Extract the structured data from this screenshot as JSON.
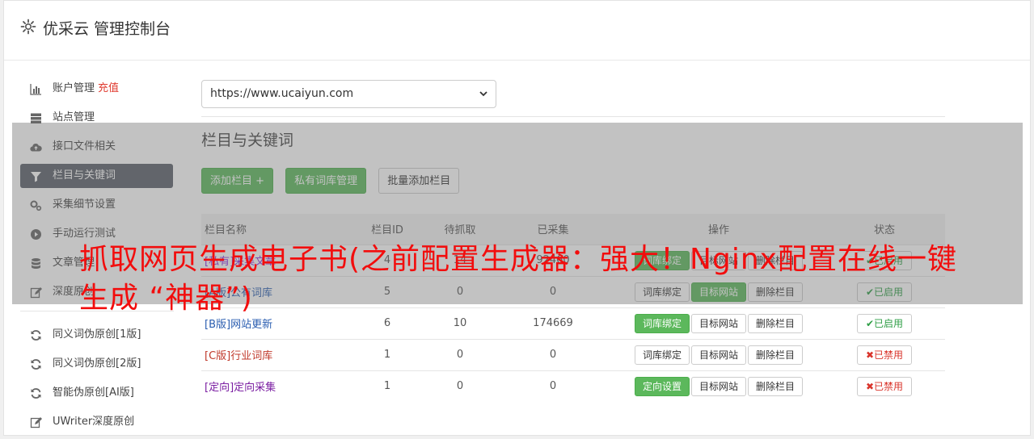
{
  "header": {
    "title": "优采云 管理控制台",
    "icon": "gear-icon"
  },
  "sidebar": {
    "items": [
      {
        "label": "账户管理",
        "extra": "充值",
        "icon": "bar-chart-icon"
      },
      {
        "label": "站点管理",
        "icon": "server-icon"
      },
      {
        "label": "接口文件相关",
        "icon": "cloud-upload-icon"
      },
      {
        "label": "栏目与关键词",
        "icon": "filter-icon",
        "active": true
      },
      {
        "label": "采集细节设置",
        "icon": "gears-icon"
      },
      {
        "label": "手动运行测试",
        "icon": "play-icon"
      },
      {
        "label": "文章管理",
        "icon": "database-icon"
      },
      {
        "label": "深度原创",
        "icon": "edit-icon"
      }
    ],
    "items2": [
      {
        "label": "同义词伪原创[1版]",
        "icon": "refresh-icon"
      },
      {
        "label": "同义词伪原创[2版]",
        "icon": "refresh-icon"
      },
      {
        "label": "智能伪原创[AI版]",
        "icon": "refresh-icon"
      },
      {
        "label": "UWriter深度原创",
        "icon": "edit-icon"
      }
    ]
  },
  "main": {
    "site_select": "https://www.ucaiyun.com",
    "section_title": "栏目与关键词",
    "buttons": {
      "add": "添加栏目 +",
      "private": "私有词库管理",
      "batch": "批量添加栏目"
    },
    "columns": [
      "栏目名称",
      "栏目ID",
      "待抓取",
      "已采集",
      "操作",
      "状态"
    ],
    "rows": [
      {
        "tag": "[私有]",
        "name": "采集文章",
        "id": "4",
        "pending": "14",
        "collected": "92460",
        "bind": "词库绑定",
        "bind_green": true,
        "target": "目标网站",
        "del": "删除栏目",
        "status": "已启用",
        "on": true
      },
      {
        "tag": "[A版]",
        "name": "公有词库",
        "id": "5",
        "pending": "0",
        "collected": "0",
        "bind": "词库绑定",
        "bind_green": false,
        "target": "目标网站",
        "del": "删除栏目",
        "status": "已启用",
        "on": true
      },
      {
        "tag": "[B版]",
        "name": "网站更新",
        "id": "6",
        "pending": "10",
        "collected": "174669",
        "bind": "词库绑定",
        "bind_green": true,
        "target": "目标网站",
        "del": "删除栏目",
        "status": "已启用",
        "on": true
      },
      {
        "tag": "[C版]",
        "name": "行业词库",
        "id": "1",
        "pending": "0",
        "collected": "0",
        "bind": "词库绑定",
        "bind_green": false,
        "target": "目标网站",
        "del": "删除栏目",
        "status": "已禁用",
        "on": false
      },
      {
        "tag": "[定向]",
        "name": "定向采集",
        "id": "1",
        "pending": "0",
        "collected": "0",
        "bind": "定向设置",
        "bind_green": true,
        "target": "目标网站",
        "del": "删除栏目",
        "status": "已禁用",
        "on": false
      }
    ]
  },
  "overlay_text": "抓取网页生成电子书(之前配置生成器：强大！Nginx配置在线一键生成 “神器”)"
}
